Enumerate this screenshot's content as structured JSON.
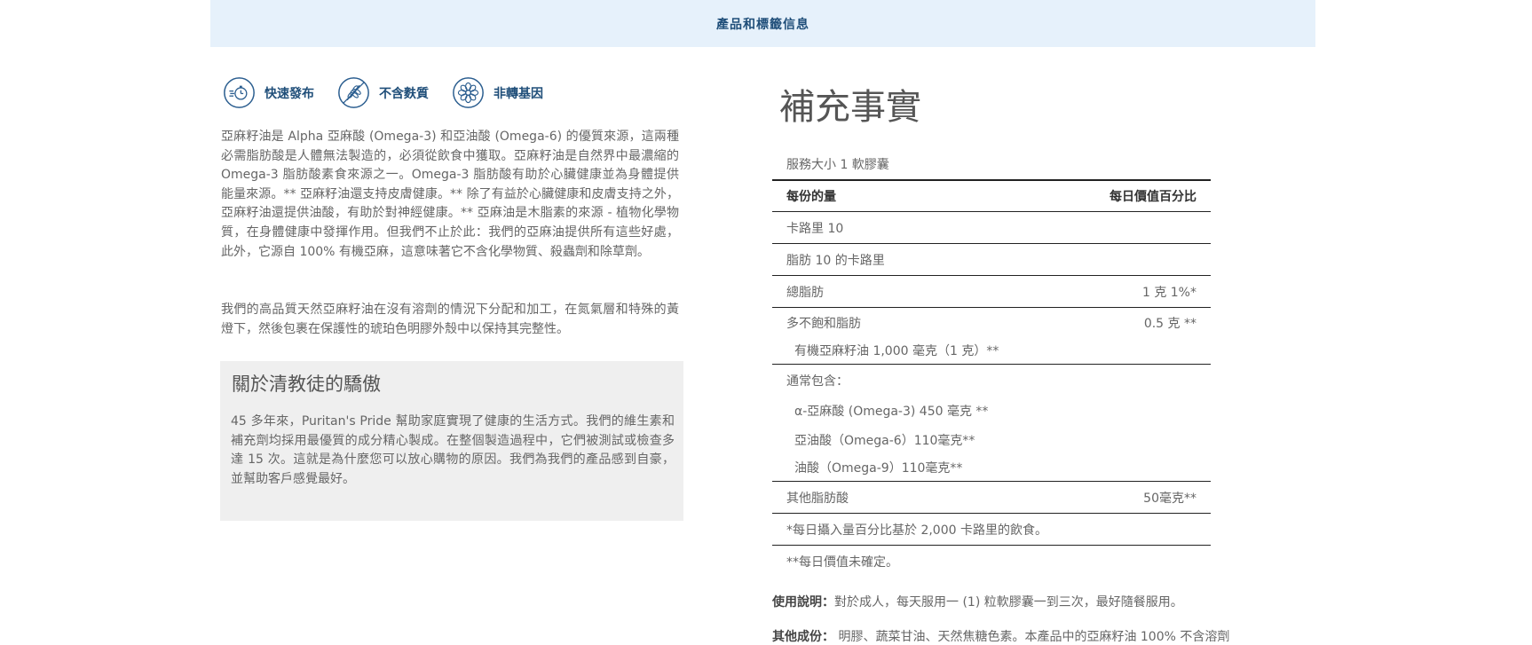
{
  "banner": {
    "title": "產品和標籤信息"
  },
  "features": [
    {
      "icon": "quick-release-icon",
      "label": "快速發布"
    },
    {
      "icon": "gluten-free-icon",
      "label": "不含麩質"
    },
    {
      "icon": "non-gmo-icon",
      "label": "非轉基因"
    }
  ],
  "description": {
    "p1": "亞麻籽油是 Alpha 亞麻酸 (Omega-3) 和亞油酸 (Omega-6) 的優質來源，這兩種必需脂肪酸是人體無法製造的，必須從飲食中獲取。亞麻籽油是自然界中最濃縮的 Omega-3 脂肪酸素食來源之一。Omega-3 脂肪酸有助於心臟健康並為身體提供能量來源。** 亞麻籽油還支持皮膚健康。** 除了有益於心臟健康和皮膚支持之外，亞麻籽油還提供油酸，有助於對神經健康。** 亞麻油是木脂素的來源 - 植物化學物質，在身體健康中發揮作用。但我們不止於此：我們的亞麻油提供所有這些好處，此外，它源自 100% 有機亞麻，這意味著它不含化學物質、殺蟲劑和除草劑。",
    "p2": "我們的高品質天然亞麻籽油在沒有溶劑的情況下分配和加工，在氮氣層和特殊的黃燈下，然後包裹在保護性的琥珀色明膠外殼中以保持其完整性。"
  },
  "about": {
    "title": "關於清教徒的驕傲",
    "text": "45 多年來，Puritan's Pride 幫助家庭實現了健康的生活方式。我們的維生素和補充劑均採用最優質的成分精心製成。在整個製造過程中，它們被測試或檢查多達 15 次。這就是為什麼您可以放心購物的原因。我們為我們的產品感到自豪，並幫助客戶感覺最好。"
  },
  "facts": {
    "title": "補充事實",
    "serving_size": "服務大小 1 軟膠囊",
    "col_amount": "每份的量",
    "col_dv": "每日價值百分比",
    "calories": "卡路里 10",
    "fat_calories": "脂肪 10 的卡路里",
    "total_fat": {
      "name": "總脂肪",
      "value": "1 克 1%*"
    },
    "poly_fat": {
      "name": "多不飽和脂肪",
      "value": "0.5 克 **"
    },
    "flax_oil": "有機亞麻籽油 1,000 毫克（1 克）**",
    "typically_contains": "通常包含：",
    "ala": "α-亞麻酸 (Omega-3) 450 毫克 **",
    "linoleic": "亞油酸（Omega-6）110毫克**",
    "oleic": "油酸（Omega-9）110毫克**",
    "other_fats": {
      "name": "其他脂肪酸",
      "value": "50毫克**"
    },
    "footnote1": "*每日攝入量百分比基於 2,000 卡路里的飲食。",
    "footnote2": "**每日價值未確定。"
  },
  "usage": {
    "directions_label": "使用說明：",
    "directions": "對於成人，每天服用一 (1) 粒軟膠囊一到三次，最好隨餐服用。",
    "ingredients_label": "其他成份：",
    "ingredients": " 明膠、蔬菜甘油、天然焦糖色素。本產品中的亞麻籽油 100% 不含溶劑"
  }
}
